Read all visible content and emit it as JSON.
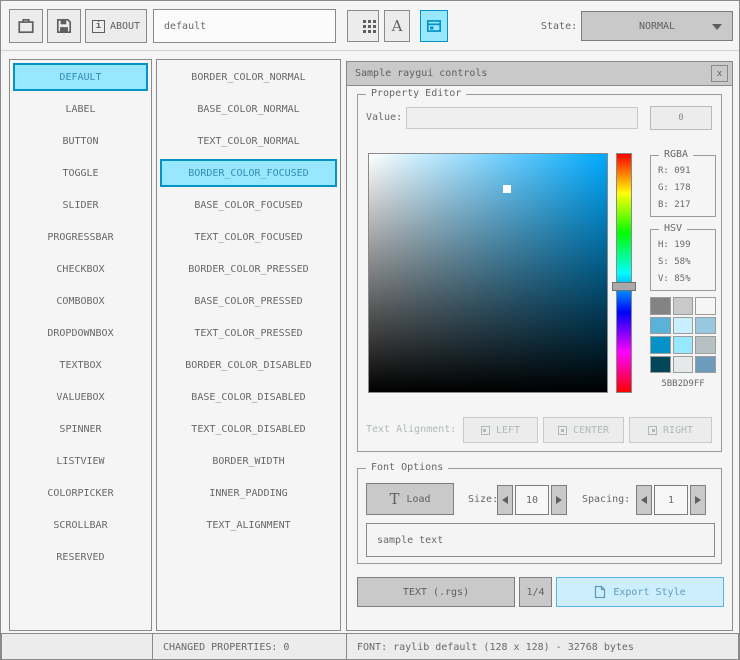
{
  "toolbar": {
    "about_label": "ABOUT",
    "info_glyph": "i",
    "font_tool_glyph": "A",
    "style_name": "default",
    "state_label": "State:",
    "state_value": "NORMAL"
  },
  "controls_list": {
    "selected_index": 0,
    "items": [
      "DEFAULT",
      "LABEL",
      "BUTTON",
      "TOGGLE",
      "SLIDER",
      "PROGRESSBAR",
      "CHECKBOX",
      "COMBOBOX",
      "DROPDOWNBOX",
      "TEXTBOX",
      "VALUEBOX",
      "SPINNER",
      "LISTVIEW",
      "COLORPICKER",
      "SCROLLBAR",
      "RESERVED"
    ]
  },
  "properties_list": {
    "selected_index": 3,
    "items": [
      "BORDER_COLOR_NORMAL",
      "BASE_COLOR_NORMAL",
      "TEXT_COLOR_NORMAL",
      "BORDER_COLOR_FOCUSED",
      "BASE_COLOR_FOCUSED",
      "TEXT_COLOR_FOCUSED",
      "BORDER_COLOR_PRESSED",
      "BASE_COLOR_PRESSED",
      "TEXT_COLOR_PRESSED",
      "BORDER_COLOR_DISABLED",
      "BASE_COLOR_DISABLED",
      "TEXT_COLOR_DISABLED",
      "BORDER_WIDTH",
      "INNER_PADDING",
      "TEXT_ALIGNMENT"
    ]
  },
  "sample_window": {
    "title": "Sample raygui controls",
    "close_label": "x",
    "property_editor": {
      "title": "Property Editor",
      "value_label": "Value:",
      "value_button_label": "0",
      "rgba": {
        "title": "RGBA",
        "r": "R: 091",
        "g": "G: 178",
        "b": "B: 217"
      },
      "hsv": {
        "title": "HSV",
        "h": "H: 199",
        "s": "S: 58%",
        "v": "V: 85%"
      },
      "hex_value": "5BB2D9FF",
      "swatches": [
        "#838383",
        "#c9c9c9",
        "#f5f5f5",
        "#5bb2d9",
        "#c9effe",
        "#97c8e0",
        "#0492c7",
        "#97e8ff",
        "#b5c1c2",
        "#024658",
        "#e6e9e9",
        "#6c9bbc"
      ],
      "text_alignment_label": "Text Alignment:",
      "align_options": [
        "LEFT",
        "CENTER",
        "RIGHT"
      ]
    },
    "font_options": {
      "title": "Font Options",
      "load_glyph": "T",
      "load_button": "Load",
      "size_label": "Size:",
      "size_value": "10",
      "spacing_label": "Spacing:",
      "spacing_value": "1",
      "sample_text": "sample text"
    },
    "footer": {
      "export_format": "TEXT (.rgs)",
      "pager": "1/4",
      "export_button": "Export Style"
    }
  },
  "statusbar": {
    "left": "",
    "changed_properties": "CHANGED PROPERTIES: 0",
    "font_info": "FONT: raylib default (128 x 128) - 32768 bytes"
  },
  "colors": {
    "selection_bg": "#97e8ff",
    "selection_border": "#0492c7",
    "focused_bg": "#c9effe",
    "focused_border": "#5bb2d9",
    "picker_hue_color": "#00aaff",
    "picked_rgb": "#5bb2d9"
  }
}
